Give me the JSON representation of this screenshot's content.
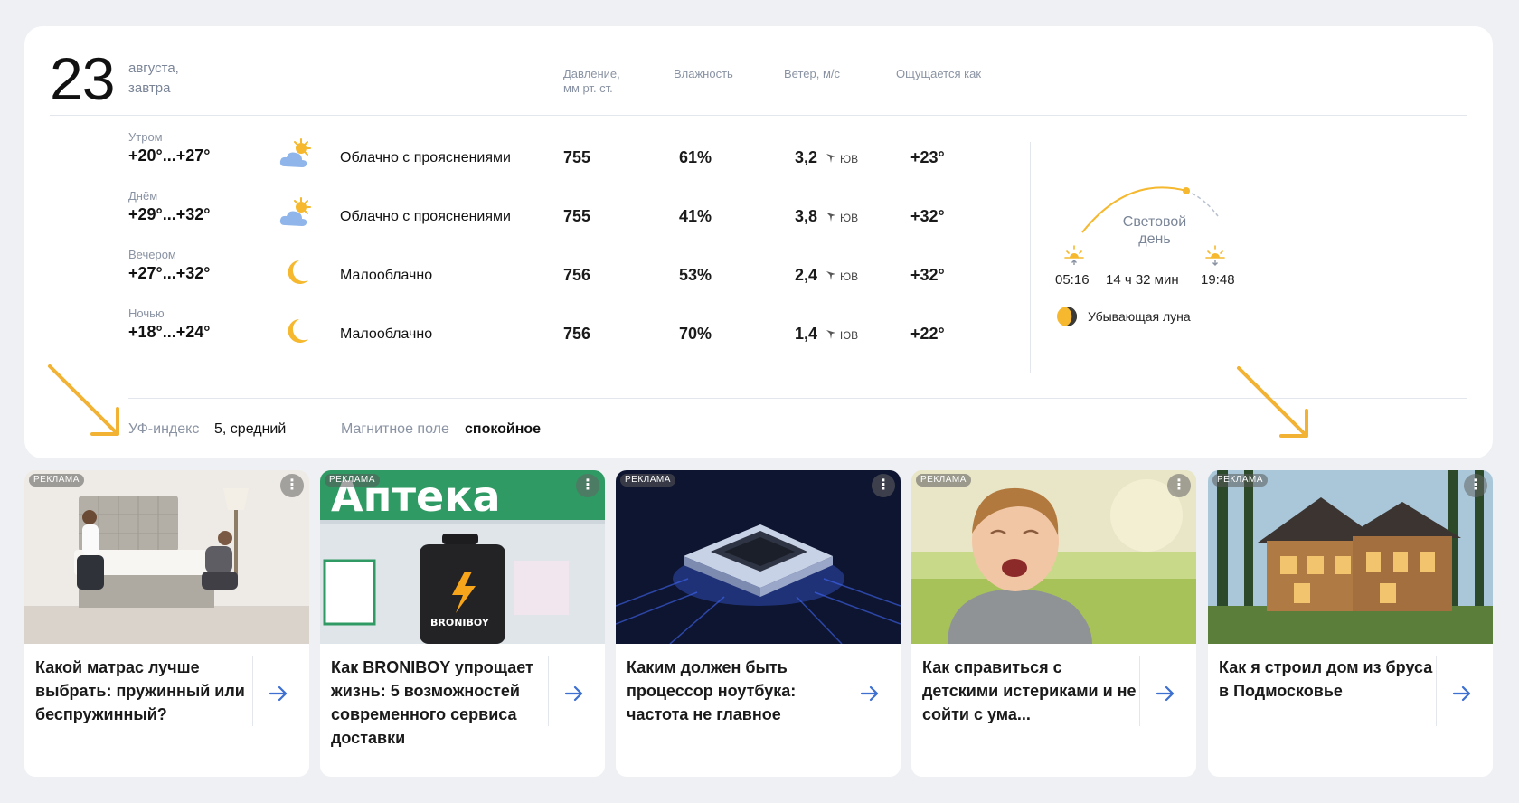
{
  "header": {
    "day_number": "23",
    "day_line1": "августа,",
    "day_line2": "завтра",
    "col_pressure_1": "Давление,",
    "col_pressure_2": "мм рт. ст.",
    "col_humidity": "Влажность",
    "col_wind": "Ветер, м/с",
    "col_feels": "Ощущается как"
  },
  "rows": [
    {
      "label": "Утром",
      "temp": "+20°...+27°",
      "icon": "partly-cloudy-icon",
      "condition": "Облачно с прояснениями",
      "pressure": "755",
      "humidity": "61%",
      "wind": "3,2",
      "wind_dir": "ЮВ",
      "feels": "+23°"
    },
    {
      "label": "Днём",
      "temp": "+29°...+32°",
      "icon": "partly-cloudy-icon",
      "condition": "Облачно с прояснениями",
      "pressure": "755",
      "humidity": "41%",
      "wind": "3,8",
      "wind_dir": "ЮВ",
      "feels": "+32°"
    },
    {
      "label": "Вечером",
      "temp": "+27°...+32°",
      "icon": "moon-icon",
      "condition": "Малооблачно",
      "pressure": "756",
      "humidity": "53%",
      "wind": "2,4",
      "wind_dir": "ЮВ",
      "feels": "+32°"
    },
    {
      "label": "Ночью",
      "temp": "+18°...+24°",
      "icon": "moon-icon",
      "condition": "Малооблачно",
      "pressure": "756",
      "humidity": "70%",
      "wind": "1,4",
      "wind_dir": "ЮВ",
      "feels": "+22°"
    }
  ],
  "daylight": {
    "title_1": "Световой",
    "title_2": "день",
    "sunrise": "05:16",
    "length": "14 ч 32 мин",
    "sunset": "19:48",
    "moon_phase": "Убывающая луна"
  },
  "footer": {
    "uv_label": "УФ-индекс",
    "uv_value": "5, средний",
    "magnetic_label": "Магнитное поле",
    "magnetic_value": "спокойное"
  },
  "ads": [
    {
      "badge": "РЕКЛАМА",
      "title": "Какой матрас лучше выбрать: пружинный или беспружинный?"
    },
    {
      "badge": "РЕКЛАМА",
      "title": "Как BRONIBOY упрощает жизнь: 5 возможностей современного сервиса доставки"
    },
    {
      "badge": "РЕКЛАМА",
      "title": "Каким должен быть процессор ноутбука: частота не главное"
    },
    {
      "badge": "РЕКЛАМА",
      "title": "Как справиться с детскими истериками и не сойти с ума..."
    },
    {
      "badge": "РЕКЛАМА",
      "title": "Как я строил дом из бруса в Подмосковье"
    }
  ],
  "ad_images": {
    "ad2_sign": "Аптека",
    "ad2_bag": "BRONIBOY"
  },
  "colors": {
    "accent_link": "#3d6fd1",
    "annotation_arrow": "#f2b233",
    "muted_text": "#8a93a3"
  }
}
